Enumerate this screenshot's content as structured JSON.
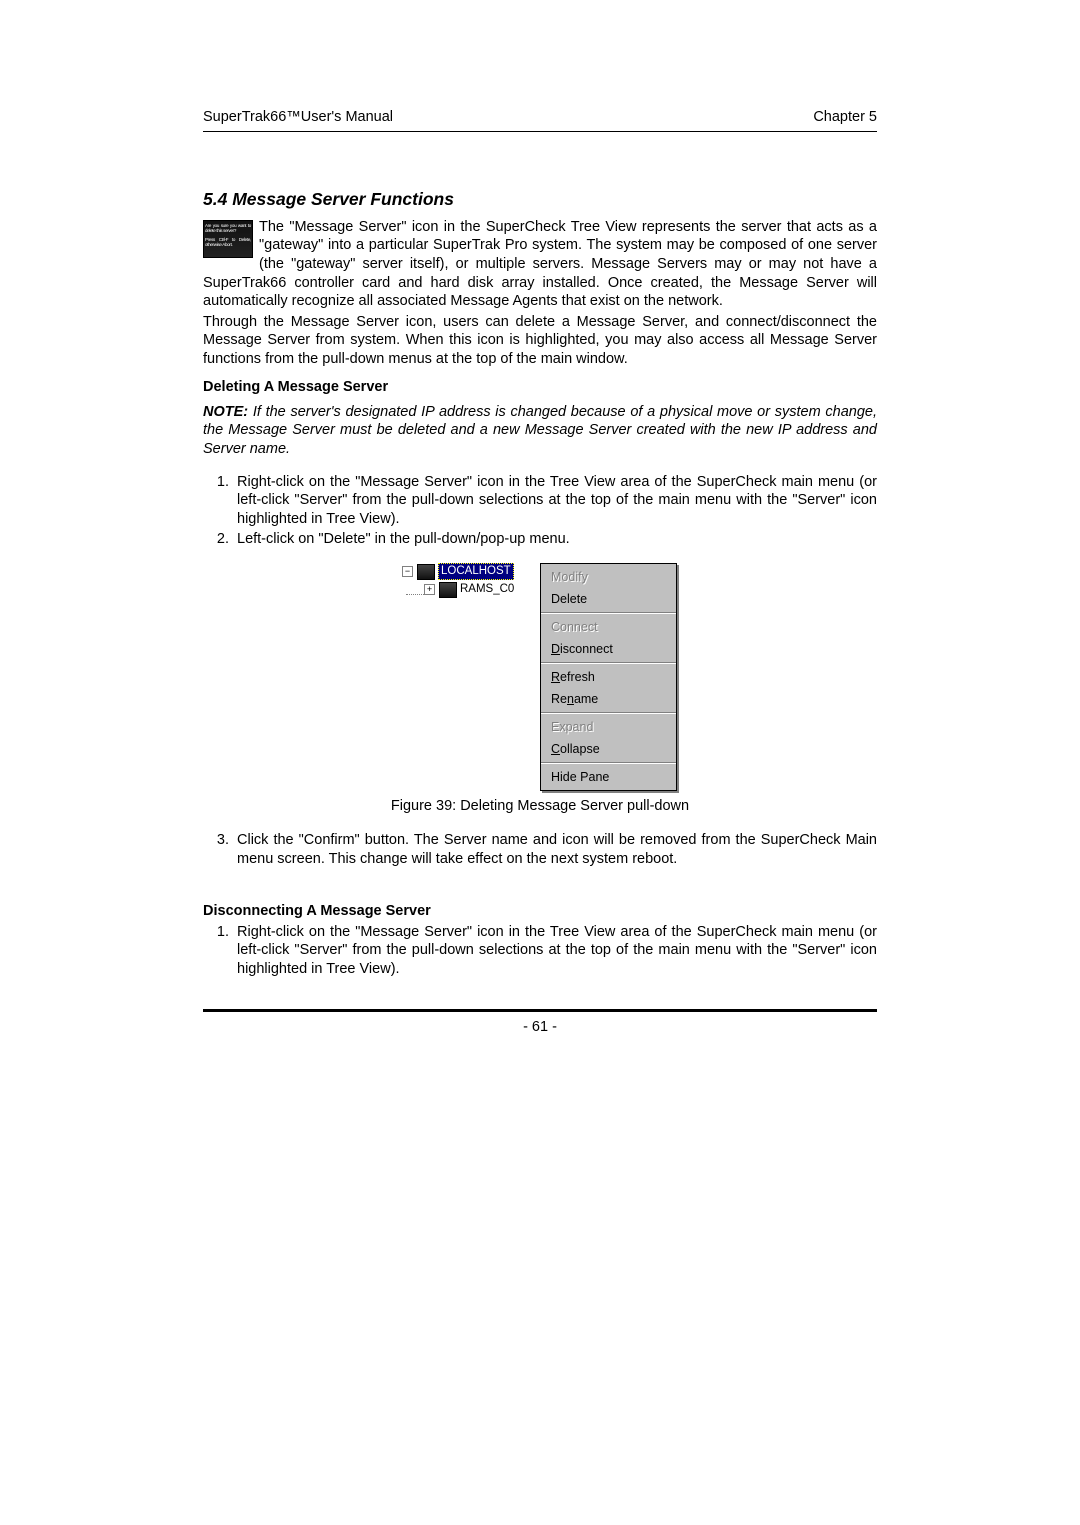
{
  "header": {
    "left": "SuperTrak66™User's Manual",
    "right": "Chapter 5"
  },
  "section_title": "5.4 Message Server Functions",
  "icon_text": {
    "l1": "Are you sure you want to delete this server?",
    "l2": "Press Ctrl-F to Delete, otherwise Abort."
  },
  "intro": "The \"Message Server\" icon in the SuperCheck Tree View represents the server that acts as a \"gateway\" into a particular SuperTrak Pro system. The system may be composed of one server (the \"gateway\" server itself), or multiple servers. Message Servers may or may not have a SuperTrak66 controller card and hard disk array installed. Once created, the Message Server will automatically recognize all associated Message Agents that exist on the network.",
  "intro2": "Through the Message Server icon, users can delete a Message Server, and connect/disconnect the Message Server from system. When this icon is highlighted, you may also access all Message Server functions from the pull-down menus at the top of the main window.",
  "del_head": "Deleting A Message Server",
  "note_label": "NOTE:",
  "note_body": " If the server's designated IP address is changed because of a physical move or system change, the Message Server must be deleted and a new Message Server created with the new IP address and Server name.",
  "steps_a": [
    "Right-click on the \"Message Server\" icon in the Tree View area of the SuperCheck main menu (or left-click \"Server\" from the pull-down selections at the top of the main menu with the \"Server\" icon highlighted in Tree View).",
    "Left-click on \"Delete\" in the pull-down/pop-up menu."
  ],
  "tree": {
    "node1": "LOCALHOST",
    "node2": "RAMS_C0"
  },
  "menu": {
    "modify": "Modify",
    "delete": "Delete",
    "connect": "Connect",
    "disconnect": "Disconnect",
    "refresh": "Refresh",
    "rename": "Rename",
    "expand": "Expand",
    "collapse": "Collapse",
    "hidepane": "Hide Pane"
  },
  "fig_caption": "Figure 39: Deleting Message Server pull-down",
  "steps_b": [
    "Click the \"Confirm\" button. The Server name and icon will be removed from the SuperCheck Main menu screen. This change will take effect on the next system reboot."
  ],
  "disc_head": "Disconnecting A Message Server",
  "steps_c": [
    "Right-click on the \"Message Server\" icon in the Tree View area of the SuperCheck main menu (or left-click \"Server\" from the pull-down selections at the top of the main menu with the \"Server\" icon highlighted in Tree View)."
  ],
  "page_num": "- 61 -"
}
